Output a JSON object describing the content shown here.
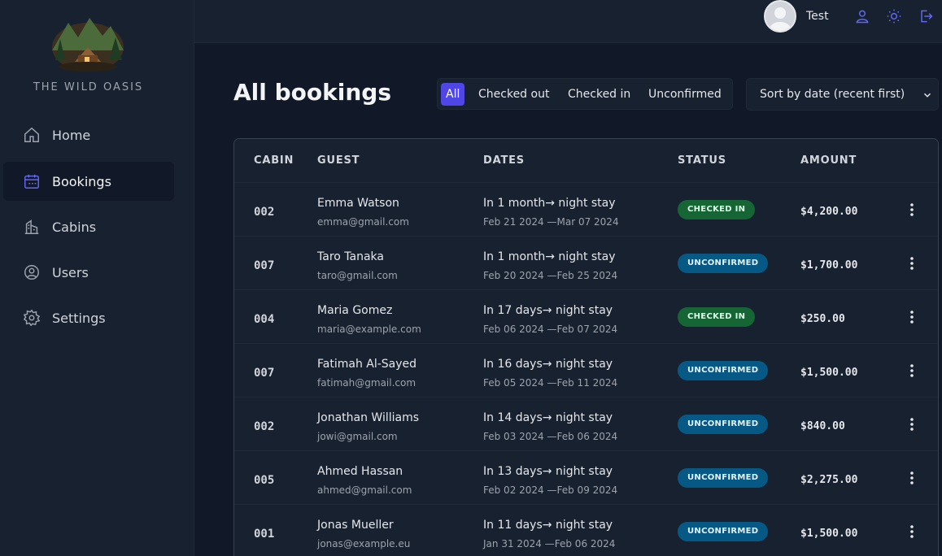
{
  "brand": {
    "name": "THE WILD OASIS",
    "logo_icon": "cabin-in-forest-logo"
  },
  "nav": [
    {
      "label": "Home",
      "icon": "home-icon",
      "active": false
    },
    {
      "label": "Bookings",
      "icon": "calendar-icon",
      "active": true
    },
    {
      "label": "Cabins",
      "icon": "cabins-icon",
      "active": false
    },
    {
      "label": "Users",
      "icon": "users-icon",
      "active": false
    },
    {
      "label": "Settings",
      "icon": "gear-icon",
      "active": false
    }
  ],
  "header": {
    "username": "Test",
    "icons": [
      "user-icon",
      "sun-icon",
      "logout-icon"
    ]
  },
  "page": {
    "title": "All bookings",
    "filters": [
      {
        "label": "All",
        "active": true
      },
      {
        "label": "Checked out",
        "active": false
      },
      {
        "label": "Checked in",
        "active": false
      },
      {
        "label": "Unconfirmed",
        "active": false
      }
    ],
    "sort": {
      "selected": "Sort by date (recent first)"
    }
  },
  "table": {
    "headers": [
      "CABIN",
      "GUEST",
      "DATES",
      "STATUS",
      "AMOUNT"
    ],
    "rows": [
      {
        "cabin": "002",
        "guest": "Emma Watson",
        "email": "emma@gmail.com",
        "when": "In 1 month→ night stay",
        "range": "Feb 21 2024 —Mar 07 2024",
        "status": "CHECKED IN",
        "amount": "$4,200.00"
      },
      {
        "cabin": "007",
        "guest": "Taro Tanaka",
        "email": "taro@gmail.com",
        "when": "In 1 month→ night stay",
        "range": "Feb 20 2024 —Feb 25 2024",
        "status": "UNCONFIRMED",
        "amount": "$1,700.00"
      },
      {
        "cabin": "004",
        "guest": "Maria Gomez",
        "email": "maria@example.com",
        "when": "In 17 days→ night stay",
        "range": "Feb 06 2024 —Feb 07 2024",
        "status": "CHECKED IN",
        "amount": "$250.00"
      },
      {
        "cabin": "007",
        "guest": "Fatimah Al-Sayed",
        "email": "fatimah@gmail.com",
        "when": "In 16 days→ night stay",
        "range": "Feb 05 2024 —Feb 11 2024",
        "status": "UNCONFIRMED",
        "amount": "$1,500.00"
      },
      {
        "cabin": "002",
        "guest": "Jonathan Williams",
        "email": "jowi@gmail.com",
        "when": "In 14 days→ night stay",
        "range": "Feb 03 2024 —Feb 06 2024",
        "status": "UNCONFIRMED",
        "amount": "$840.00"
      },
      {
        "cabin": "005",
        "guest": "Ahmed Hassan",
        "email": "ahmed@gmail.com",
        "when": "In 13 days→ night stay",
        "range": "Feb 02 2024 —Feb 09 2024",
        "status": "UNCONFIRMED",
        "amount": "$2,275.00"
      },
      {
        "cabin": "001",
        "guest": "Jonas Mueller",
        "email": "jonas@example.eu",
        "when": "In 11 days→ night stay",
        "range": "Jan 31 2024 —Feb 06 2024",
        "status": "UNCONFIRMED",
        "amount": "$1,500.00"
      }
    ]
  },
  "colors": {
    "accent": "#4f46e5",
    "checked_in_badge": "#166534",
    "unconfirmed_badge": "#075985",
    "background": "#111827",
    "panel": "#18212f"
  }
}
